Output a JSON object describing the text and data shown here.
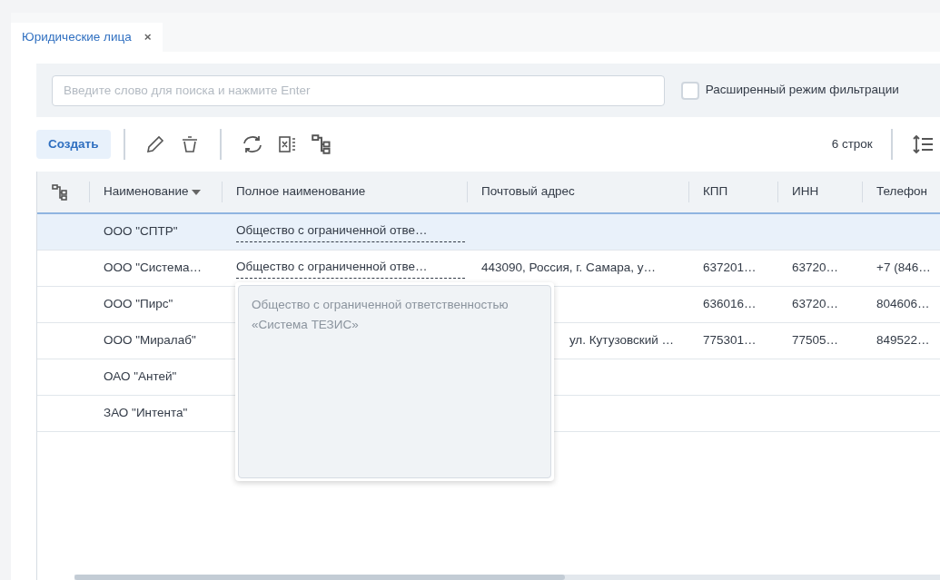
{
  "tabs": [
    {
      "label": "Юридические лица",
      "selected": true,
      "close": "×"
    }
  ],
  "search": {
    "placeholder": "Введите слово для поиска и нажмите Enter"
  },
  "advanced_filter": {
    "label": "Расширенный режим фильтрации",
    "checked": false
  },
  "toolbar": {
    "create": "Создать",
    "row_count": "6 строк"
  },
  "table": {
    "columns": [
      {
        "label": "Наименование",
        "sorted": true
      },
      {
        "label": "Полное наименование",
        "sorted": false
      },
      {
        "label": "Почтовый адрес",
        "sorted": false
      },
      {
        "label": "КПП",
        "sorted": false
      },
      {
        "label": "ИНН",
        "sorted": false
      },
      {
        "label": "Телефон",
        "sorted": false
      }
    ],
    "rows": [
      {
        "selected": true,
        "cells": [
          "ООО \"СПТР\"",
          "Общество с ограниченной отве…",
          "",
          "",
          "",
          ""
        ]
      },
      {
        "selected": false,
        "cells": [
          "ООО \"Система…",
          "Общество с ограниченной отве…",
          "443090, Россия, г. Самара, у…",
          "637201…",
          "63720…",
          "+7 (846…"
        ]
      },
      {
        "selected": false,
        "cells": [
          "ООО \"Пирс\"",
          "",
          "",
          "636016…",
          "63720…",
          "804606…"
        ]
      },
      {
        "selected": false,
        "address_under_popover": true,
        "cells": [
          "ООО \"Миралаб\"",
          "",
          "ул. Кутузовский …",
          "775301…",
          "77505…",
          "849522…"
        ]
      },
      {
        "selected": false,
        "cells": [
          "ОАО \"Антей\"",
          "",
          "",
          "",
          "",
          ""
        ]
      },
      {
        "selected": false,
        "cells": [
          "ЗАО \"Интента\"",
          "",
          "",
          "",
          "",
          ""
        ]
      }
    ]
  },
  "popover": {
    "text": "Общество с ограниченной ответственностью «Система ТЕЗИС»"
  }
}
